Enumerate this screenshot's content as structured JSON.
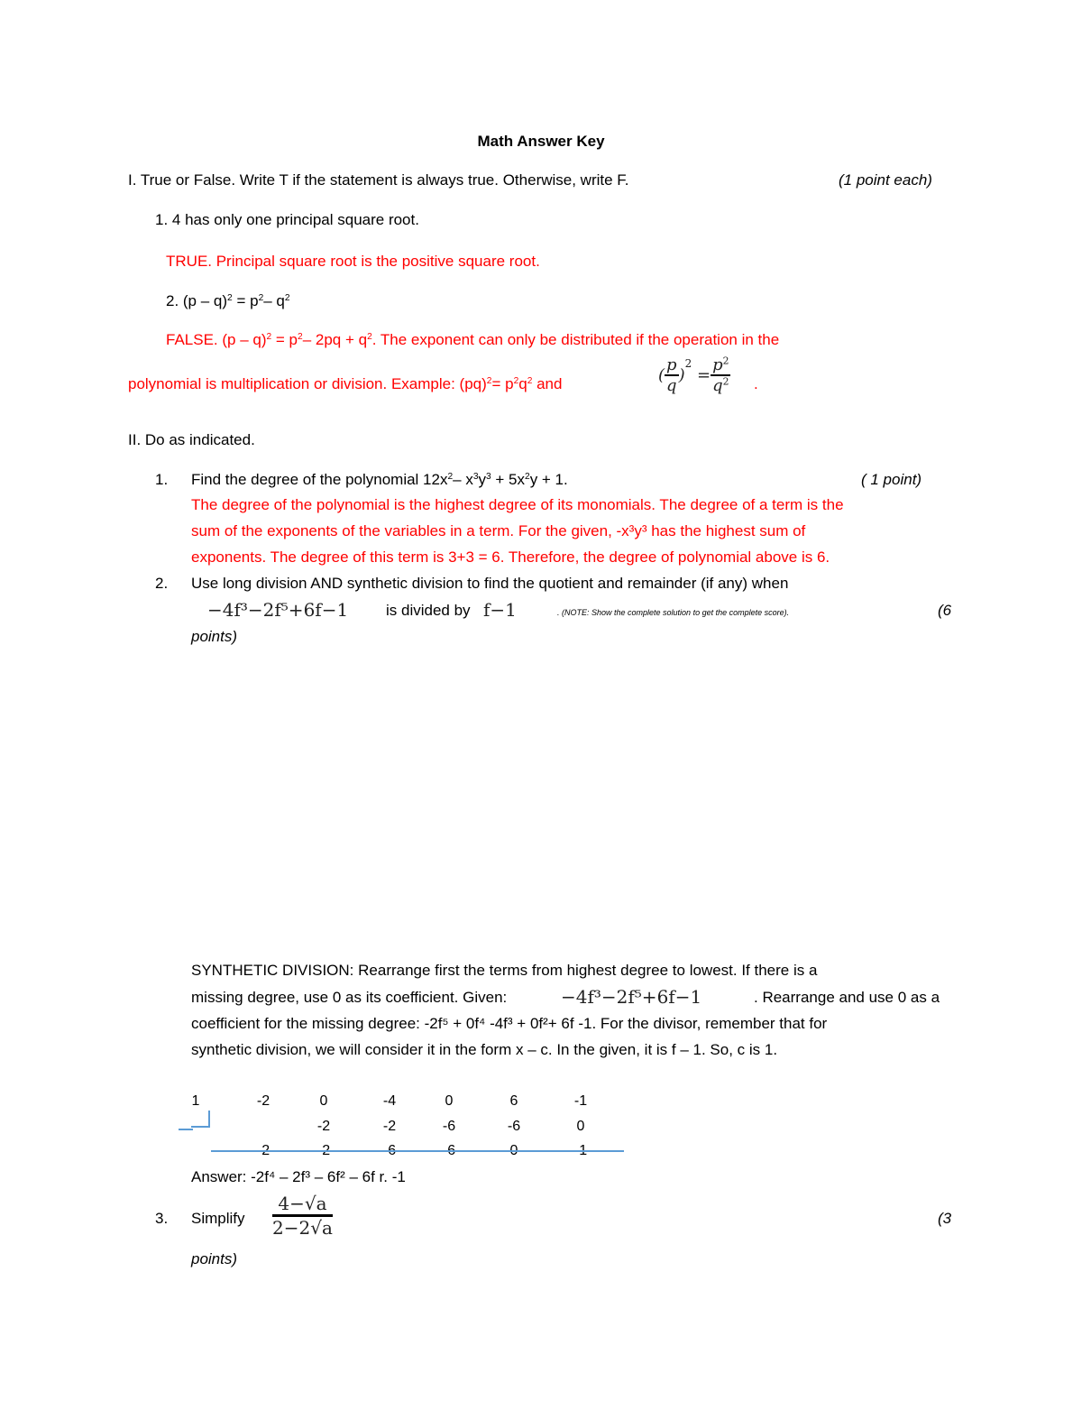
{
  "title": "Math Answer Key",
  "section1": {
    "heading": "I. True or False. Write T if the statement is always true. Otherwise, write F.",
    "points": "(1 point each)",
    "q1": {
      "text": "1. 4 has only one principal square root.",
      "answer": "TRUE. Principal square root is the positive square root."
    },
    "q2": {
      "label": "2. (p – q)",
      "eq_rest_a": " = p",
      "eq_rest_b": "– q",
      "sup2": "2",
      "answer_prefix": "FALSE. (p – q)",
      "answer_mid1": " = p",
      "answer_mid2": "– 2pq + q",
      "answer_tail": ". The exponent can only be distributed if the operation in the",
      "answer_line2_a": "polynomial is multiplication or division. Example: (pq)",
      "answer_line2_b": "= p",
      "answer_line2_c": "q",
      "answer_line2_d": " and",
      "example_p": "p",
      "example_q": "q",
      "example_eq": "=",
      "period": "."
    }
  },
  "section2": {
    "heading": "II. Do as indicated.",
    "q1": {
      "number": "1.",
      "text_a": "Find the degree of the polynomial 12x",
      "text_b": "– x",
      "text_c": "y",
      "text_d": " + 5x",
      "text_e": "y + 1.",
      "points": "( 1 point)",
      "answer_lines": [
        "The degree of the polynomial is the highest degree of its monomials. The degree of a term is the",
        "sum of the exponents of the variables in a term. For the given, -x³y³ has the highest sum of",
        "exponents. The degree of this term is 3+3 = 6. Therefore, the degree of polynomial above is 6."
      ]
    },
    "q2": {
      "number": "2.",
      "text": "Use long division AND synthetic division to find the quotient and remainder (if any) when",
      "dividend": "−4f³−2f⁵+6f−1",
      "divided_by": "is divided by",
      "divisor": "f−1",
      "note": ". (NOTE: Show the complete solution to get the complete score).",
      "points_a": "(6",
      "points_b": "points)"
    },
    "synthetic": {
      "lines": [
        "SYNTHETIC DIVISION: Rearrange first the terms from highest degree to lowest. If there is a",
        "missing degree, use 0 as its coefficient. Given:",
        ". Rearrange and use 0 as a",
        "coefficient for the missing degree: -2f⁵ + 0f⁴ -4f³ + 0f²+ 6f -1. For the divisor, remember that for",
        "synthetic division, we will consider it in the form x – c. In the given, it is f – 1. So, c is 1."
      ],
      "given_expr": "−4f³−2f⁵+6f−1",
      "table": {
        "divisor": "1",
        "row1": [
          "-2",
          "0",
          "-4",
          "0",
          "6",
          "-1"
        ],
        "row2": [
          "",
          "-2",
          "-2",
          "-6",
          "-6",
          "0"
        ],
        "row3": [
          "-2",
          "-2",
          "-6",
          "-6",
          "0",
          "-1"
        ]
      },
      "answer": "Answer: -2f⁴ – 2f³ – 6f² – 6f r. -1"
    },
    "q3": {
      "number": "3.",
      "text": "Simplify",
      "numerator": "4−√a",
      "denominator": "2−2√a",
      "points_a": "(3",
      "points_b": "points)"
    }
  }
}
